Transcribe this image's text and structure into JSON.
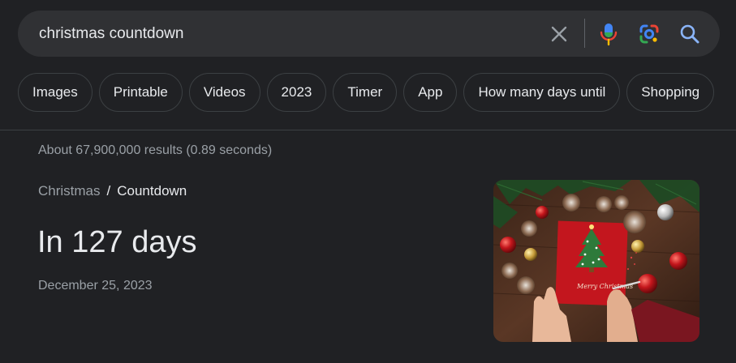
{
  "search": {
    "query": "christmas countdown",
    "clear_icon": "close-icon",
    "mic_icon": "microphone-icon",
    "lens_icon": "lens-icon",
    "search_icon": "search-icon"
  },
  "chips": [
    "Images",
    "Printable",
    "Videos",
    "2023",
    "Timer",
    "App",
    "How many days until",
    "Shopping"
  ],
  "results": {
    "stats": "About 67,900,000 results (0.89 seconds)"
  },
  "answer": {
    "breadcrumb_parent": "Christmas",
    "breadcrumb_separator": "/",
    "breadcrumb_current": "Countdown",
    "headline": "In 127 days",
    "date": "December 25, 2023",
    "image_text": "Merry Christmas"
  },
  "colors": {
    "background": "#202124",
    "search_bar": "#303134",
    "chip_border": "#3c4043",
    "secondary_text": "#9aa0a6",
    "primary_text": "#e8eaed",
    "search_accent": "#8ab4f8"
  }
}
